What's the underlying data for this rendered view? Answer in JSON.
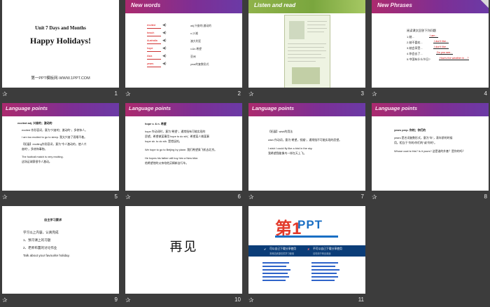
{
  "slides": [
    {
      "num": "1",
      "sub": "Unit 7 Days and Months",
      "title": "Happy Holidays!",
      "foot": "第一PPT模板网-WWW.1PPT.COM"
    },
    {
      "num": "2",
      "header": "New words",
      "words": [
        "excited",
        "beach",
        "Australia",
        "hope",
        "Asia",
        "years"
      ],
      "meanings": [
        "adj.兴奋的;激动的",
        "n.沙滩",
        "澳大利亚",
        "v.&n.希望",
        "亚洲",
        "year的复数形式"
      ]
    },
    {
      "num": "3",
      "header": "Listen and read"
    },
    {
      "num": "4",
      "header": "New Phrases",
      "intro": "阅读课文回答下列问题",
      "rows": [
        "1.她...",
        "2.她不喜欢...",
        "3.她会享受...",
        "4.你会去了...",
        "5.中国有什么节日?"
      ],
      "answers": [
        "I am...",
        "I don't like...",
        "I don't like...",
        "Do you see...",
        "How's the weather in ...?"
      ]
    },
    {
      "num": "5",
      "header": "Language points",
      "lines": [
        "excited adj. 兴奋的；激动的",
        "excited 作形容词，意为\"兴奋的；激动的\"，多修饰人。",
        "I am too excited to go to sleep. 我太兴奋了而睡不着。",
        "【拓展】exciting作形容词，意为\"令人激动的，使人兴",
        "奋的\"，多修饰事物。",
        "The football match is very exciting.",
        "这场足球赛很令人激动。"
      ]
    },
    {
      "num": "6",
      "header": "Language points",
      "lines": [
        "hope v. & n. 希望",
        "hope 作动词时，意为\"希望\"，通常指有可能实现的",
        "愿望。希望做某事用 hope to do sth；希望某人做某事",
        "hope sb. to do sth. 是错误的。",
        "We hope to go to Beijing by plane. 我们希望乘飞机去北京。",
        "He hopes his father will buy him a New bike.",
        "他希望他的父亲给他买辆新自行车。"
      ]
    },
    {
      "num": "7",
      "header": "Language points",
      "lines": [
        "【拓展】wish的用法",
        "wish 作动词，意为\"希望，祝福\"，通常指不可能实现的愿望。",
        "I wish I could fly like a bird in the sky.",
        "我希望我能像鸟一样在天上飞。"
      ]
    },
    {
      "num": "8",
      "header": "Language points",
      "lines": [
        "years prep. 你的；你们的",
        "years 是名词复数形式，意为\"年\"，表年龄的时候",
        "用。相当于\"你的/你们的\"或\"你的\"。",
        "Whose coat is this? Is it yours? 这是谁的外套？是你的吗？"
      ]
    },
    {
      "num": "9",
      "lines": [
        "自主学习要求",
        "学习以上内容，认真完成",
        "1、预习课上的习题",
        "2、老师布置的讨论作业",
        "Talk about your favourite holiday."
      ]
    },
    {
      "num": "10",
      "text": "再见"
    },
    {
      "num": "11",
      "logo1": "第1",
      "logo2": "PPT",
      "band1": "可以自己下载分享使用",
      "band2": "不可以自己下载分享使用",
      "sub1": "本网站资源仅供学习使用",
      "sub2": "请勿用于商业用途"
    }
  ],
  "icons": {
    "star": "✰"
  },
  "colors": {
    "background": "#3c3c3c",
    "header_purple": "#ab2a6e",
    "header_green": "#8fb24a"
  }
}
